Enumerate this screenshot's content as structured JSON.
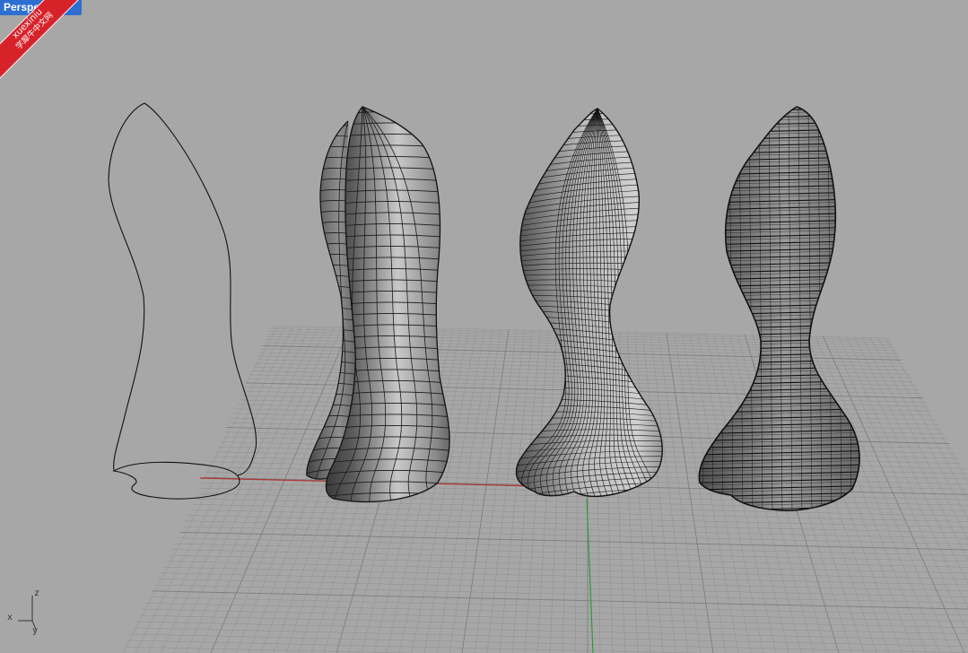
{
  "viewport": {
    "title": "Perspective",
    "display_mode": "Shaded",
    "background_color": "#a7a7a7",
    "grid_line_color": "#8f8f8f",
    "grid_major_color": "#7e7e7e",
    "x_axis_color": "#b03030",
    "y_axis_color": "#2e9a3a"
  },
  "watermark": {
    "brand": "xuexiniu",
    "subtitle": "学犀牛中文网",
    "color": "#d8222a"
  },
  "axis_widget": {
    "x": "x",
    "y": "y",
    "z": "z"
  },
  "objects": [
    {
      "kind": "curve",
      "display": "wireframe"
    },
    {
      "kind": "surface",
      "display": "shaded with isocurves"
    },
    {
      "kind": "surface",
      "display": "dense isocurve mesh"
    },
    {
      "kind": "contour slices",
      "display": "stacked sections"
    }
  ]
}
